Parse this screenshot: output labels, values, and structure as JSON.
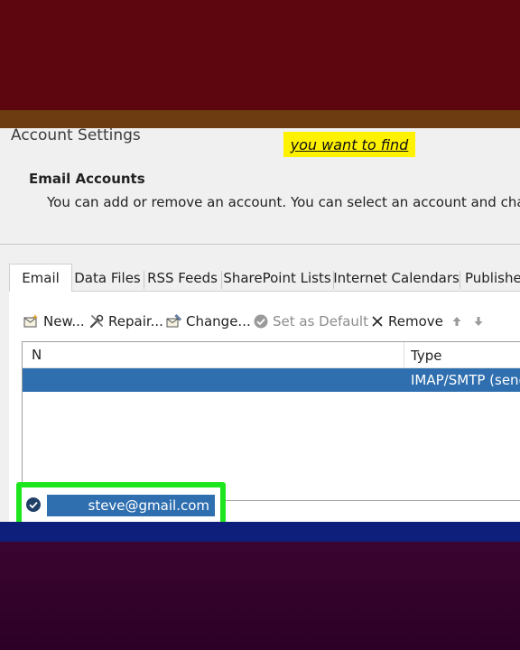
{
  "dialog": {
    "title": "Account Settings",
    "highlight_text": "you want to find",
    "section_heading": "Email Accounts",
    "description": "You can add or remove an account. You can select an account and change i"
  },
  "tabs": [
    {
      "label": "Email",
      "active": true
    },
    {
      "label": "Data Files"
    },
    {
      "label": "RSS Feeds"
    },
    {
      "label": "SharePoint Lists"
    },
    {
      "label": "Internet Calendars"
    },
    {
      "label": "Publishe"
    }
  ],
  "toolbar": {
    "new_label": "New...",
    "repair_label": "Repair...",
    "change_label": "Change...",
    "set_default_label": "Set as Default",
    "remove_label": "Remove"
  },
  "list": {
    "col_name": "N",
    "col_type": "Type",
    "rows": [
      {
        "name": "steve@gmail.com",
        "type": "IMAP/SMTP (senc"
      }
    ]
  },
  "colors": {
    "selection": "#2f6fb0",
    "highlight": "#fff200",
    "callout": "#1ee61e"
  }
}
